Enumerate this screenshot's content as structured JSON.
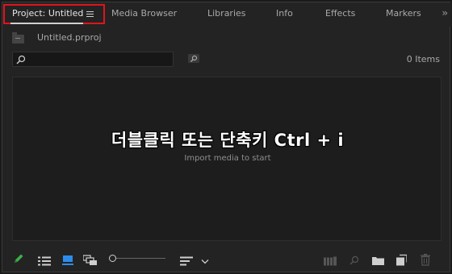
{
  "tabs": [
    {
      "label": "Project: Untitled",
      "active": true
    },
    {
      "label": "Media Browser"
    },
    {
      "label": "Libraries"
    },
    {
      "label": "Info"
    },
    {
      "label": "Effects"
    },
    {
      "label": "Markers"
    }
  ],
  "project": {
    "file_name": "Untitled.prproj",
    "items_count": "0 Items"
  },
  "search": {
    "placeholder": ""
  },
  "drop_area": {
    "overlay_text": "더블클릭 또는 단축키 Ctrl + i",
    "hint": "Import media to start"
  },
  "colors": {
    "accent": "#2d8ceb",
    "pencil": "#3fae49",
    "highlight_box": "#e0141c"
  },
  "icons": [
    "menu-icon",
    "overflow-icon",
    "folder-icon",
    "search-icon",
    "bin-search-icon",
    "pencil-icon",
    "list-view-icon",
    "icon-view-icon",
    "freeform-view-icon",
    "sort-icon",
    "automate-icon",
    "find-icon",
    "new-bin-icon",
    "new-item-icon",
    "clear-icon"
  ]
}
